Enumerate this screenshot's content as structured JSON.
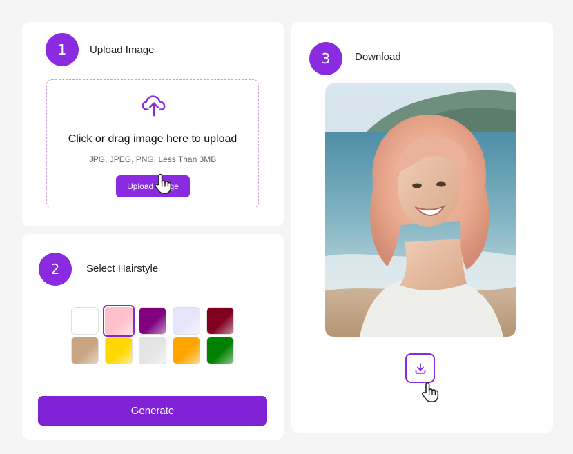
{
  "steps": {
    "upload": {
      "number": "1",
      "title": "Upload Image"
    },
    "style": {
      "number": "2",
      "title": "Select Hairstyle"
    },
    "download": {
      "number": "3",
      "title": "Download"
    }
  },
  "dropzone": {
    "title": "Click or drag image here to upload",
    "hint": "JPG, JPEG, PNG, Less Than 3MB",
    "button_label": "Upload Image"
  },
  "swatches": [
    {
      "color": "#ffffff",
      "selected": false
    },
    {
      "color": "#ffc0cb",
      "selected": true
    },
    {
      "color": "#800080",
      "selected": false
    },
    {
      "color": "#e6e6fa",
      "selected": false
    },
    {
      "color": "#800020",
      "selected": false
    },
    {
      "color": "#c8a581",
      "selected": false
    },
    {
      "color": "#ffd700",
      "selected": false
    },
    {
      "color": "#e5e5e5",
      "selected": false
    },
    {
      "color": "#ffa500",
      "selected": false
    },
    {
      "color": "#008000",
      "selected": false
    }
  ],
  "generate_label": "Generate",
  "colors": {
    "accent": "#8a2be2",
    "button": "#7f22d6",
    "background": "#f5f5f5"
  },
  "icons": {
    "upload": "cloud-upload-icon",
    "download": "download-icon",
    "cursor": "hand-pointer-icon"
  }
}
